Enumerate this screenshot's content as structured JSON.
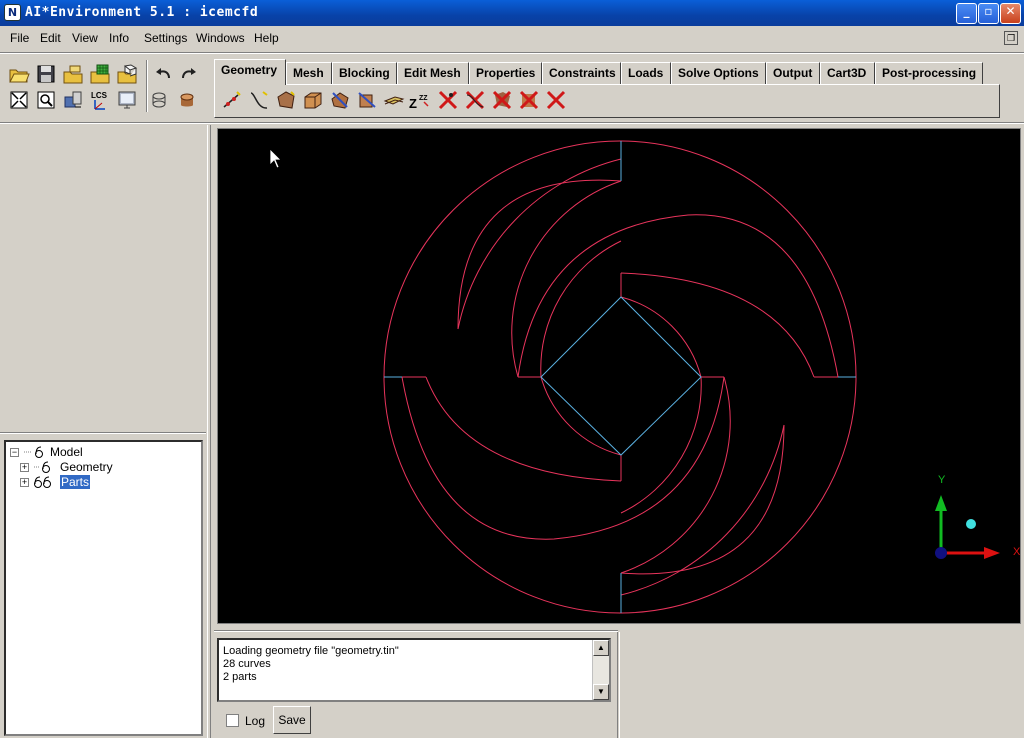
{
  "window": {
    "title": "AI*Environment 5.1 : icemcfd",
    "icon_letter": "N",
    "buttons": {
      "minimize": "_",
      "maximize": "▫",
      "close": "✕"
    }
  },
  "menu": [
    {
      "label": "File"
    },
    {
      "label": "Edit"
    },
    {
      "label": "View"
    },
    {
      "label": "Info"
    },
    {
      "label": "Settings"
    },
    {
      "label": "Windows"
    },
    {
      "label": "Help"
    }
  ],
  "tabs": [
    {
      "label": "Geometry",
      "active": true
    },
    {
      "label": "Mesh"
    },
    {
      "label": "Blocking"
    },
    {
      "label": "Edit Mesh"
    },
    {
      "label": "Properties"
    },
    {
      "label": "Constraints"
    },
    {
      "label": "Loads"
    },
    {
      "label": "Solve Options"
    },
    {
      "label": "Output"
    },
    {
      "label": "Cart3D"
    },
    {
      "label": "Post-processing"
    }
  ],
  "toolbar": {
    "file_icons": [
      "open-folder-icon",
      "save-icon",
      "open-geometry-icon",
      "open-mesh-icon",
      "open-blocking-icon"
    ],
    "view_icons": [
      "fit-window-icon",
      "zoom-box-icon",
      "measure-icon",
      "local-coord-icon",
      "screen-icon"
    ],
    "undo_icons": [
      "undo-icon",
      "redo-icon"
    ],
    "render_icons": [
      "wireframe-icon",
      "solid-icon"
    ],
    "geometry_icons": [
      "create-point-icon",
      "create-curve-icon",
      "create-surface-icon",
      "create-body-icon",
      "repair-geometry-icon",
      "transform-geometry-icon",
      "edit-curve-icon",
      "restore-dormant-icon",
      "delete-point-icon",
      "delete-curve-icon",
      "delete-surface-icon",
      "delete-body-icon",
      "delete-any-icon"
    ]
  },
  "tree": {
    "root": "Model",
    "children": [
      {
        "label": "Geometry",
        "selected": false
      },
      {
        "label": "Parts",
        "selected": true
      }
    ]
  },
  "messages": {
    "lines": [
      "Loading geometry file \"geometry.tin\"",
      "28 curves",
      "2 parts"
    ]
  },
  "bottom": {
    "log_label": "Log",
    "log_checked": false,
    "save_label": "Save"
  },
  "axes": {
    "y_label": "Y",
    "x_label": "X"
  },
  "colors": {
    "curve": "#e8345c",
    "boundary": "#5ab0e0",
    "viewport_bg": "#000000",
    "axis_x": "#dd1111",
    "axis_y": "#11bb22",
    "axis_origin": "#101080"
  }
}
